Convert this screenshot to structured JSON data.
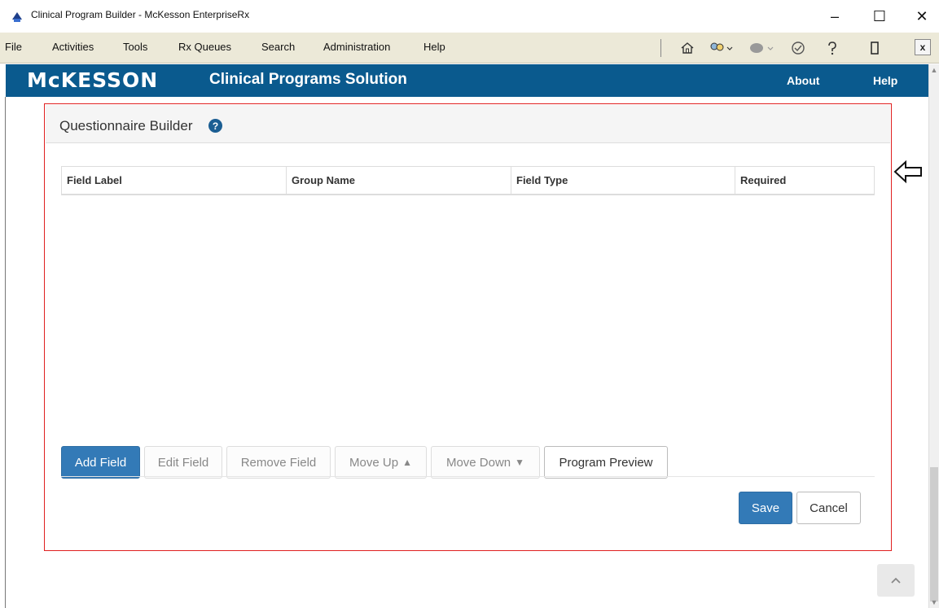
{
  "window": {
    "title": "Clinical Program Builder - McKesson EnterpriseRx",
    "minimize": "–",
    "maximize": "☐",
    "close": "✕"
  },
  "menu": {
    "items": [
      {
        "label": "File"
      },
      {
        "label": "Activities"
      },
      {
        "label": "Tools"
      },
      {
        "label": "Rx Queues"
      },
      {
        "label": "Search"
      },
      {
        "label": "Administration"
      },
      {
        "label": "Help"
      }
    ],
    "mdi_close": "x"
  },
  "toolbar": {
    "icons": [
      "home-icon",
      "users-icon",
      "record-icon",
      "shield-icon",
      "help-icon",
      "window-icon"
    ]
  },
  "header": {
    "logo": "McKESSON",
    "app_name": "Clinical Programs Solution",
    "about": "About",
    "help": "Help",
    "color": "#0a5a8e"
  },
  "builder": {
    "title": "Questionnaire Builder",
    "help_glyph": "?",
    "columns": [
      "Field Label",
      "Group Name",
      "Field Type",
      "Required"
    ],
    "rows": [],
    "actions": {
      "add_field": "Add Field",
      "edit_field": "Edit Field",
      "remove_field": "Remove Field",
      "move_up": "Move Up",
      "move_down": "Move Down",
      "program_preview": "Program Preview"
    },
    "save": "Save",
    "cancel": "Cancel"
  },
  "colors": {
    "accent": "#337ab7",
    "highlight": "#e02020"
  }
}
